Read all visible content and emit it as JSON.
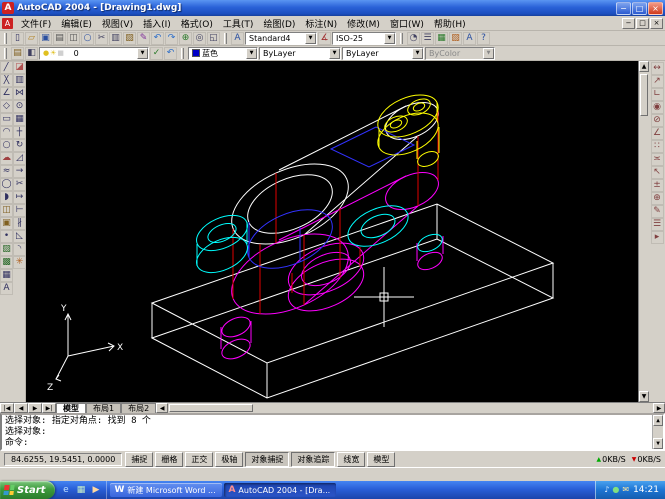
{
  "titlebar": {
    "title": "AutoCAD 2004 - [Drawing1.dwg]",
    "app_icon": "A",
    "minimize": "−",
    "maximize": "□",
    "close": "×"
  },
  "menubar": {
    "doc_icon": "A",
    "items": [
      {
        "label": "文件(F)",
        "name": "menu-file"
      },
      {
        "label": "编辑(E)",
        "name": "menu-edit"
      },
      {
        "label": "视图(V)",
        "name": "menu-view"
      },
      {
        "label": "插入(I)",
        "name": "menu-insert"
      },
      {
        "label": "格式(O)",
        "name": "menu-format"
      },
      {
        "label": "工具(T)",
        "name": "menu-tools"
      },
      {
        "label": "绘图(D)",
        "name": "menu-draw"
      },
      {
        "label": "标注(N)",
        "name": "menu-dimension"
      },
      {
        "label": "修改(M)",
        "name": "menu-modify"
      },
      {
        "label": "窗口(W)",
        "name": "menu-window"
      },
      {
        "label": "帮助(H)",
        "name": "menu-help"
      }
    ],
    "mdi": {
      "minimize": "−",
      "restore": "□",
      "close": "×"
    }
  },
  "standard_toolbar": [
    {
      "glyph": "▯",
      "color": "#303060",
      "name": "new-icon"
    },
    {
      "glyph": "▱",
      "color": "#b08020",
      "name": "open-icon"
    },
    {
      "glyph": "▣",
      "color": "#2a4fa0",
      "name": "save-icon"
    },
    {
      "glyph": "▤",
      "color": "#505050",
      "name": "print-icon"
    },
    {
      "glyph": "◫",
      "color": "#505050",
      "name": "print-preview-icon"
    },
    {
      "glyph": "○",
      "color": "#2a4fa0",
      "name": "find-icon"
    },
    {
      "glyph": "✂",
      "color": "#404060",
      "name": "cut-icon"
    },
    {
      "glyph": "▥",
      "color": "#404060",
      "name": "copy-clip-icon"
    },
    {
      "glyph": "▨",
      "color": "#806020",
      "name": "paste-icon"
    },
    {
      "glyph": "✎",
      "color": "#80309a",
      "name": "match-properties-icon"
    },
    {
      "glyph": "↶",
      "color": "#2a6cc8",
      "name": "undo-icon"
    },
    {
      "glyph": "↷",
      "color": "#2a6cc8",
      "name": "redo-icon"
    },
    {
      "glyph": "⊕",
      "color": "#2a7a2a",
      "name": "pan-icon"
    },
    {
      "glyph": "◎",
      "color": "#404060",
      "name": "zoom-realtime-icon"
    },
    {
      "glyph": "◱",
      "color": "#404060",
      "name": "zoom-window-icon"
    }
  ],
  "styles_toolbar": {
    "text_style_icon": "A",
    "text_style": "Standard4",
    "dim_style_icon": "∡",
    "dim_style": "ISO-25"
  },
  "extra_toolbar": [
    {
      "glyph": "◔",
      "color": "#404060",
      "name": "zoom-previous-icon"
    },
    {
      "glyph": "☰",
      "color": "#404060",
      "name": "properties-icon"
    },
    {
      "glyph": "▦",
      "color": "#2a7a2a",
      "name": "designcenter-icon"
    },
    {
      "glyph": "▧",
      "color": "#b06020",
      "name": "tool-palettes-icon"
    },
    {
      "glyph": "A",
      "color": "#2a4fa0",
      "name": "text-icon"
    },
    {
      "glyph": "?",
      "color": "#2a4fa0",
      "name": "help-icon"
    }
  ],
  "layers_toolbar": {
    "icons_left": [
      {
        "glyph": "▤",
        "color": "#806020",
        "name": "layer-properties-icon"
      },
      {
        "glyph": "◧",
        "color": "#404060",
        "name": "layer-states-icon"
      }
    ],
    "layer_glyphs": [
      {
        "glyph": "●",
        "color": "#e0c020",
        "name": "layer-on-icon"
      },
      {
        "glyph": "☀",
        "color": "#e0c020",
        "name": "layer-thaw-icon"
      },
      {
        "glyph": "■",
        "color": "#d0d0d0",
        "name": "layer-unlock-icon"
      },
      {
        "glyph": "■",
        "color": "#ffffff",
        "name": "layer-color-icon"
      }
    ],
    "layer_name": "0",
    "icons_right": [
      {
        "glyph": "✓",
        "color": "#2a7a2a",
        "name": "make-layer-current-icon"
      },
      {
        "glyph": "↶",
        "color": "#2a6cc8",
        "name": "layer-previous-icon"
      }
    ],
    "color_swatch": "#0000c8",
    "color_name": "蓝色",
    "linetype": "ByLayer",
    "lineweight": "ByLayer",
    "plot_style": "ByColor"
  },
  "draw_toolbar": [
    {
      "glyph": "╱",
      "color": "#303060",
      "name": "line-icon"
    },
    {
      "glyph": "╳",
      "color": "#303060",
      "name": "construction-line-icon"
    },
    {
      "glyph": "∠",
      "color": "#303060",
      "name": "polyline-icon"
    },
    {
      "glyph": "◇",
      "color": "#303060",
      "name": "polygon-icon"
    },
    {
      "glyph": "▭",
      "color": "#303060",
      "name": "rectangle-icon"
    },
    {
      "glyph": "◠",
      "color": "#303060",
      "name": "arc-icon"
    },
    {
      "glyph": "○",
      "color": "#303060",
      "name": "circle-icon"
    },
    {
      "glyph": "☁",
      "color": "#a04040",
      "name": "revision-cloud-icon"
    },
    {
      "glyph": "≈",
      "color": "#303060",
      "name": "spline-icon"
    },
    {
      "glyph": "◯",
      "color": "#303060",
      "name": "ellipse-icon"
    },
    {
      "glyph": "◗",
      "color": "#303060",
      "name": "ellipse-arc-icon"
    },
    {
      "glyph": "◫",
      "color": "#806020",
      "name": "insert-block-icon"
    },
    {
      "glyph": "▣",
      "color": "#806020",
      "name": "make-block-icon"
    },
    {
      "glyph": "•",
      "color": "#303060",
      "name": "point-icon"
    },
    {
      "glyph": "▨",
      "color": "#2a6a2a",
      "name": "hatch-icon"
    },
    {
      "glyph": "▩",
      "color": "#2a6a2a",
      "name": "gradient-icon"
    },
    {
      "glyph": "▦",
      "color": "#303060",
      "name": "region-icon"
    },
    {
      "glyph": "A",
      "color": "#303060",
      "name": "multiline-text-icon"
    }
  ],
  "modify_toolbar": [
    {
      "glyph": "◪",
      "color": "#b05050",
      "name": "erase-icon"
    },
    {
      "glyph": "▥",
      "color": "#303060",
      "name": "copy-icon"
    },
    {
      "glyph": "⋈",
      "color": "#303060",
      "name": "mirror-icon"
    },
    {
      "glyph": "⊙",
      "color": "#303060",
      "name": "offset-icon"
    },
    {
      "glyph": "▦",
      "color": "#303060",
      "name": "array-icon"
    },
    {
      "glyph": "┼",
      "color": "#303060",
      "name": "move-icon"
    },
    {
      "glyph": "↻",
      "color": "#303060",
      "name": "rotate-icon"
    },
    {
      "glyph": "◿",
      "color": "#303060",
      "name": "scale-icon"
    },
    {
      "glyph": "→",
      "color": "#303060",
      "name": "stretch-icon"
    },
    {
      "glyph": "✂",
      "color": "#303060",
      "name": "trim-icon"
    },
    {
      "glyph": "↦",
      "color": "#303060",
      "name": "extend-icon"
    },
    {
      "glyph": "⊢",
      "color": "#303060",
      "name": "break-at-point-icon"
    },
    {
      "glyph": "∦",
      "color": "#303060",
      "name": "break-icon"
    },
    {
      "glyph": "◺",
      "color": "#303060",
      "name": "chamfer-icon"
    },
    {
      "glyph": "◝",
      "color": "#303060",
      "name": "fillet-icon"
    },
    {
      "glyph": "✳",
      "color": "#b06020",
      "name": "explode-icon"
    }
  ],
  "dim_toolbar": [
    {
      "glyph": "↔",
      "color": "#804040",
      "name": "dim-linear-icon"
    },
    {
      "glyph": "↗",
      "color": "#804040",
      "name": "dim-aligned-icon"
    },
    {
      "glyph": "∟",
      "color": "#804040",
      "name": "dim-ordinate-icon"
    },
    {
      "glyph": "◉",
      "color": "#804040",
      "name": "dim-radius-icon"
    },
    {
      "glyph": "⊘",
      "color": "#804040",
      "name": "dim-diameter-icon"
    },
    {
      "glyph": "∠",
      "color": "#804040",
      "name": "dim-angular-icon"
    },
    {
      "glyph": "∷",
      "color": "#804040",
      "name": "dim-continue-icon"
    },
    {
      "glyph": "≍",
      "color": "#804040",
      "name": "dim-baseline-icon"
    },
    {
      "glyph": "↖",
      "color": "#804040",
      "name": "dim-leader-icon"
    },
    {
      "glyph": "±",
      "color": "#804040",
      "name": "dim-tolerance-icon"
    },
    {
      "glyph": "⊕",
      "color": "#804040",
      "name": "dim-center-mark-icon"
    },
    {
      "glyph": "✎",
      "color": "#804040",
      "name": "dim-edit-icon"
    },
    {
      "glyph": "☰",
      "color": "#804040",
      "name": "dim-text-edit-icon"
    },
    {
      "glyph": "▸",
      "color": "#804040",
      "name": "dim-style-icon"
    }
  ],
  "scrollbars": {
    "up": "▲",
    "down": "▼",
    "left": "◀",
    "right": "▶"
  },
  "tabs": {
    "nav": [
      {
        "label": "|◀",
        "name": "tab-nav-first"
      },
      {
        "label": "◀",
        "name": "tab-nav-prev"
      },
      {
        "label": "▶",
        "name": "tab-nav-next"
      },
      {
        "label": "▶|",
        "name": "tab-nav-last"
      }
    ],
    "items": [
      {
        "label": "模型",
        "name": "tab-model",
        "active": true
      },
      {
        "label": "布局1",
        "name": "tab-layout1"
      },
      {
        "label": "布局2",
        "name": "tab-layout2"
      }
    ]
  },
  "command": {
    "lines": [
      {
        "text": "选择对象: 指定对角点: 找到 8 个"
      },
      {
        "text": "选择对象:"
      },
      {
        "text": "命令:"
      }
    ]
  },
  "statusbar": {
    "coords": "84.6255, 19.5451, 0.0000",
    "buttons": [
      {
        "label": "捕捉",
        "name": "snap-toggle"
      },
      {
        "label": "栅格",
        "name": "grid-toggle"
      },
      {
        "label": "正交",
        "name": "ortho-toggle"
      },
      {
        "label": "极轴",
        "name": "polar-toggle"
      },
      {
        "label": "对象捕捉",
        "name": "osnap-toggle",
        "pressed": true
      },
      {
        "label": "对象追踪",
        "name": "otrack-toggle",
        "pressed": true
      },
      {
        "label": "线宽",
        "name": "lineweight-toggle"
      },
      {
        "label": "模型",
        "name": "model-space-toggle"
      }
    ],
    "net1": "0KB/S",
    "net2": "0KB/S"
  },
  "ucs": {
    "x": "X",
    "y": "Y",
    "z": "Z"
  },
  "taskbar": {
    "start": "Start",
    "quick_launch": [
      {
        "glyph": "e",
        "color": "#bfe0ff",
        "name": "ie-icon"
      },
      {
        "glyph": "▦",
        "color": "#c8f0c8",
        "name": "show-desktop-icon"
      },
      {
        "glyph": "▶",
        "color": "#ffd9a0",
        "name": "media-player-icon"
      }
    ],
    "tasks": [
      {
        "label": "新建 Microsoft Word ...",
        "glyph": "W",
        "color": "#ffffff",
        "name": "task-word"
      },
      {
        "label": "AutoCAD 2004 - [Dra...",
        "glyph": "A",
        "color": "#ff9090",
        "name": "task-autocad",
        "active": true
      }
    ],
    "tray": [
      {
        "glyph": "♪",
        "color": "#e0f0ff",
        "name": "volume-icon"
      },
      {
        "glyph": "●",
        "color": "#80e080",
        "name": "antivirus-icon"
      },
      {
        "glyph": "✉",
        "color": "#ffe9a0",
        "name": "messenger-icon"
      }
    ],
    "clock": "14:21"
  },
  "colors": {
    "wire_white": "#ffffff",
    "wire_red": "#e00000",
    "wire_magenta": "#ff00ff",
    "wire_cyan": "#00ffff",
    "wire_yellow": "#ffff00",
    "wire_blue": "#3232ff"
  }
}
